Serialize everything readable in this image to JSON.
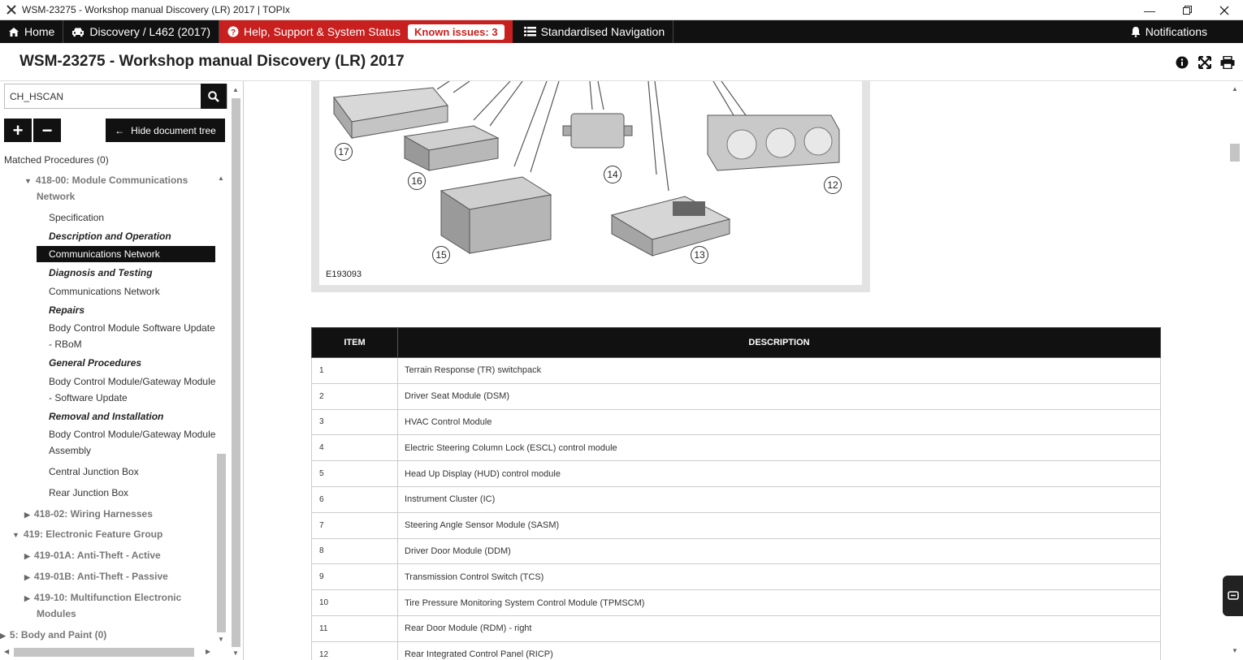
{
  "window": {
    "title": "WSM-23275 - Workshop manual Discovery (LR) 2017 | TOPIx"
  },
  "nav": {
    "home": "Home",
    "vehicle": "Discovery / L462 (2017)",
    "help": "Help, Support & System Status",
    "known_issues": "Known issues: 3",
    "standardised": "Standardised Navigation",
    "notifications": "Notifications"
  },
  "doc": {
    "title": "WSM-23275 - Workshop manual Discovery (LR) 2017"
  },
  "sidebar": {
    "search_value": "CH_HSCAN",
    "hide_tree": "Hide document tree",
    "matched": "Matched Procedures (0)",
    "tree": [
      {
        "label": "418-00: Module Communications",
        "kind": "group",
        "caret": "down"
      },
      {
        "label": "Network",
        "kind": "group-cont"
      },
      {
        "label": "Specification",
        "kind": "leaf"
      },
      {
        "label": "Description and Operation",
        "kind": "cat"
      },
      {
        "label": "Communications Network",
        "kind": "selected"
      },
      {
        "label": "Diagnosis and Testing",
        "kind": "cat"
      },
      {
        "label": "Communications Network",
        "kind": "leaf"
      },
      {
        "label": "Repairs",
        "kind": "cat"
      },
      {
        "label": "Body Control Module Software Update",
        "kind": "leaf"
      },
      {
        "label": "- RBoM",
        "kind": "leaf"
      },
      {
        "label": "General Procedures",
        "kind": "cat"
      },
      {
        "label": "Body Control Module/Gateway Module",
        "kind": "leaf"
      },
      {
        "label": "- Software Update",
        "kind": "leaf"
      },
      {
        "label": "Removal and Installation",
        "kind": "cat"
      },
      {
        "label": "Body Control Module/Gateway Module",
        "kind": "leaf"
      },
      {
        "label": "Assembly",
        "kind": "leaf"
      },
      {
        "label": "Central Junction Box",
        "kind": "leaf"
      },
      {
        "label": "Rear Junction Box",
        "kind": "leaf"
      },
      {
        "label": "418-02: Wiring Harnesses",
        "kind": "group",
        "caret": "right"
      },
      {
        "label": "419: Electronic Feature Group",
        "kind": "group",
        "caret": "down"
      },
      {
        "label": "419-01A: Anti-Theft - Active",
        "kind": "group",
        "caret": "right"
      },
      {
        "label": "419-01B: Anti-Theft - Passive",
        "kind": "group",
        "caret": "right"
      },
      {
        "label": "419-10: Multifunction Electronic",
        "kind": "group",
        "caret": "right"
      },
      {
        "label": "Modules",
        "kind": "group-cont"
      },
      {
        "label": "5: Body and Paint (0)",
        "kind": "group",
        "caret": "right"
      }
    ]
  },
  "figure": {
    "code": "E193093",
    "callouts": [
      "17",
      "16",
      "14",
      "12",
      "15",
      "13"
    ]
  },
  "table": {
    "headers": [
      "ITEM",
      "DESCRIPTION"
    ],
    "rows": [
      [
        "1",
        "Terrain Response (TR) switchpack"
      ],
      [
        "2",
        "Driver Seat Module (DSM)"
      ],
      [
        "3",
        "HVAC Control Module"
      ],
      [
        "4",
        "Electric Steering Column Lock (ESCL) control module"
      ],
      [
        "5",
        "Head Up Display (HUD) control module"
      ],
      [
        "6",
        "Instrument Cluster (IC)"
      ],
      [
        "7",
        "Steering Angle Sensor Module (SASM)"
      ],
      [
        "8",
        "Driver Door Module (DDM)"
      ],
      [
        "9",
        "Transmission Control Switch (TCS)"
      ],
      [
        "10",
        "Tire Pressure Monitoring System Control Module (TPMSCM)"
      ],
      [
        "11",
        "Rear Door Module (RDM) - right"
      ],
      [
        "12",
        "Rear Integrated Control Panel (RICP)"
      ]
    ]
  }
}
